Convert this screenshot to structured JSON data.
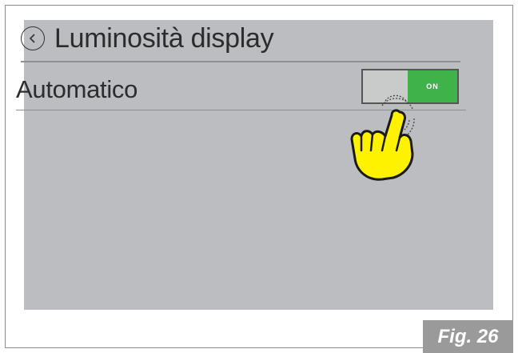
{
  "screen": {
    "title": "Luminosità display",
    "back_icon": "chevron-left-circle-icon"
  },
  "setting": {
    "label": "Automatico",
    "toggle": {
      "state_label": "ON",
      "on_color": "#3fb34a",
      "off_color": "#c9caca"
    }
  },
  "annotation": {
    "pointer_icon": "pointing-hand-icon",
    "pointer_color": "#fff200"
  },
  "figure": {
    "label": "Fig. 26"
  },
  "colors": {
    "screen_bg": "#bcbdc0",
    "text": "#2c2c2c",
    "frame": "#8a8a8a",
    "fig_bg": "#9a9a9a"
  }
}
